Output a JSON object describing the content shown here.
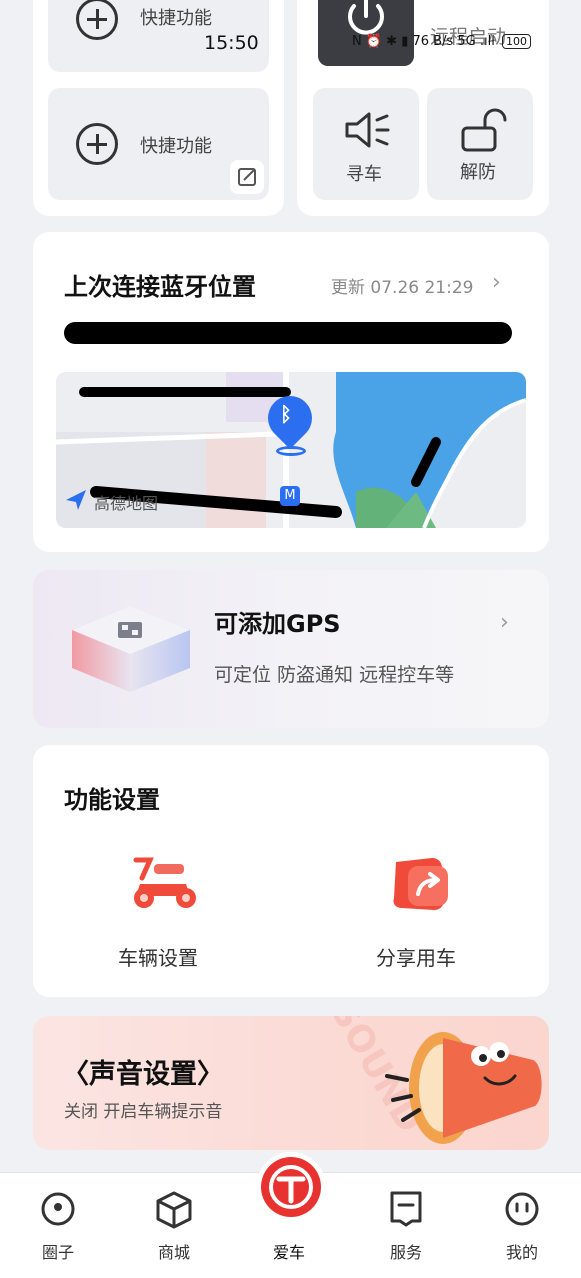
{
  "status_bar": {
    "time": "15:50",
    "icons_text": "N ⏰ ✱ ▮ 76 B/s 5G .ıll",
    "battery": "100"
  },
  "quick_actions": {
    "tile1_label": "快捷功能",
    "tile2_label": "快捷功能",
    "remote_start_label": "远程启动",
    "find_car_label": "寻车",
    "unlock_label": "解防"
  },
  "bluetooth": {
    "title": "上次连接蓝牙位置",
    "updated": "更新 07.26 21:29",
    "map_watermark": "高德地图"
  },
  "gps": {
    "title": "可添加GPS",
    "subtitle": "可定位 防盗通知 远程控车等"
  },
  "function_settings": {
    "title": "功能设置",
    "items": [
      {
        "label": "车辆设置"
      },
      {
        "label": "分享用车"
      }
    ]
  },
  "sound": {
    "title": "〈声音设置〉",
    "subtitle": "关闭 开启车辆提示音",
    "bg_text": "SOUND"
  },
  "tabbar": {
    "items": [
      {
        "label": "圈子"
      },
      {
        "label": "商城"
      },
      {
        "label": "爱车"
      },
      {
        "label": "服务"
      },
      {
        "label": "我的"
      }
    ]
  },
  "colors": {
    "accent_red": "#e8322f",
    "map_water": "#4aa3e6",
    "map_green": "#62b27a",
    "pin_blue": "#2b6ff0"
  }
}
